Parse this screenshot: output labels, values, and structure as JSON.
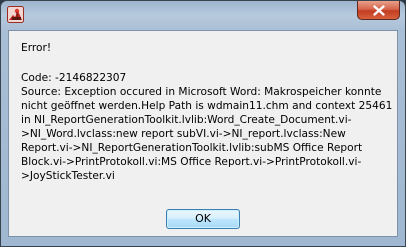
{
  "window": {
    "title": "",
    "icon": "labview-joystick-icon",
    "close_icon": "close-icon"
  },
  "dialog": {
    "heading": "Error!",
    "lines": [
      "Code: -2146822307",
      "Source: Exception occured in Microsoft Word: Makrospeicher konnte",
      "nicht geöffnet werden.Help Path is wdmain11.chm and context 25461",
      "in NI_ReportGenerationToolkit.lvlib:Word_Create_Document.vi-",
      ">NI_Word.lvclass:new report subVI.vi->NI_report.lvclass:New",
      "Report.vi->NI_ReportGenerationToolkit.lvlib:subMS Office Report",
      "Block.vi->PrintProtokoll.vi:MS Office Report.vi->PrintProtokoll.vi-",
      ">JoyStickTester.vi"
    ]
  },
  "buttons": {
    "ok_label": "OK"
  },
  "colors": {
    "title_bar": "#a9bfd6",
    "close_button": "#c33d22",
    "dialog_background": "#f0f0f0",
    "ok_button_border": "#3c7fb1"
  }
}
